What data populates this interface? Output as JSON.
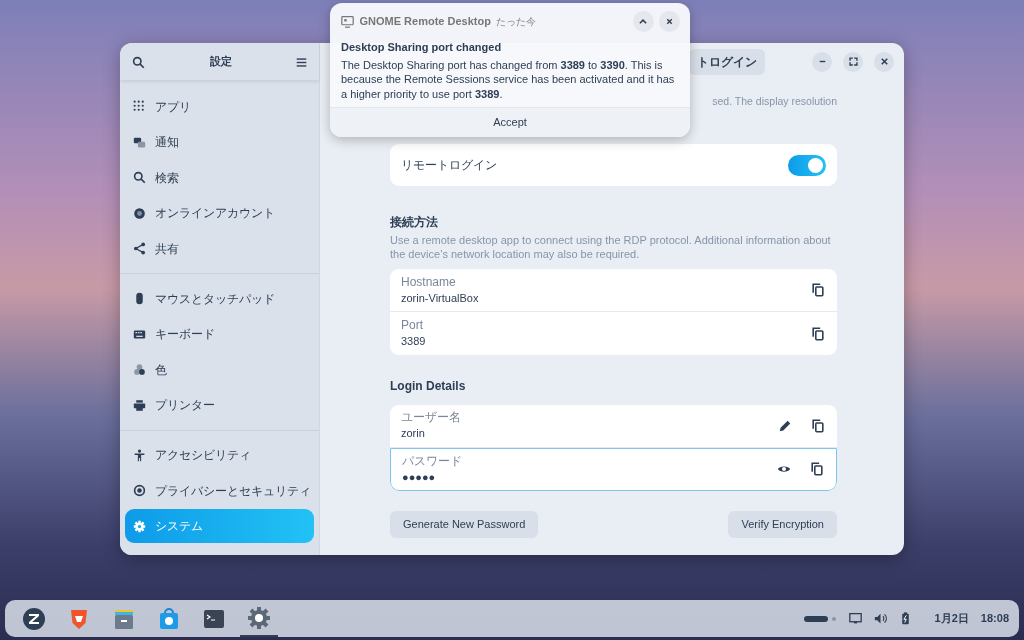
{
  "notification": {
    "app": "GNOME Remote Desktop",
    "time": "たった今",
    "title": "Desktop Sharing port changed",
    "body": "The Desktop Sharing port has changed from **3389** to **3390**. This is because the Remote Sessions service has been activated and it has a higher priority to use port **3389**.",
    "action": "Accept"
  },
  "sidebar": {
    "title": "設定",
    "groups": [
      [
        {
          "label": "アプリ",
          "selected": false
        },
        {
          "label": "通知",
          "selected": false
        },
        {
          "label": "検索",
          "selected": false
        },
        {
          "label": "オンラインアカウント",
          "selected": false
        },
        {
          "label": "共有",
          "selected": false
        }
      ],
      [
        {
          "label": "マウスとタッチパッド",
          "selected": false
        },
        {
          "label": "キーボード",
          "selected": false
        },
        {
          "label": "色",
          "selected": false
        },
        {
          "label": "プリンター",
          "selected": false
        }
      ],
      [
        {
          "label": "アクセシビリティ",
          "selected": false
        },
        {
          "label": "プライバシーとセキュリティ",
          "selected": false
        },
        {
          "label": "システム",
          "selected": true
        }
      ]
    ]
  },
  "header": {
    "tab_fragment": "トログイン"
  },
  "description_fragment": "sed. The display resolution",
  "remote_login": {
    "label": "リモートログイン",
    "on": true
  },
  "connection": {
    "heading": "接続方法",
    "description": "Use a remote desktop app to connect using the RDP protocol. Additional information about the device’s network location may also be required.",
    "rows": [
      {
        "kind": "plain",
        "label": "Hostname",
        "value": "zorin-VirtualBox",
        "focused": false
      },
      {
        "kind": "plain",
        "label": "Port",
        "value": "3389",
        "focused": false
      }
    ]
  },
  "login": {
    "heading": "Login Details",
    "rows": [
      {
        "kind": "editable",
        "label": "ユーザー名",
        "value": "zorin",
        "focused": false
      },
      {
        "kind": "secret",
        "label": "パスワード",
        "value": "●●●●●",
        "focused": true
      }
    ],
    "buttons": [
      "Generate New Password",
      "Verify Encryption"
    ]
  },
  "taskbar": {
    "apps": [
      {
        "kind": "zorin",
        "active": false
      },
      {
        "kind": "browser",
        "active": false
      },
      {
        "kind": "files",
        "active": false
      },
      {
        "kind": "store",
        "active": false
      },
      {
        "kind": "terminal",
        "active": false
      },
      {
        "kind": "settings",
        "active": true
      }
    ],
    "date": "1月2日",
    "time": "18:08"
  }
}
